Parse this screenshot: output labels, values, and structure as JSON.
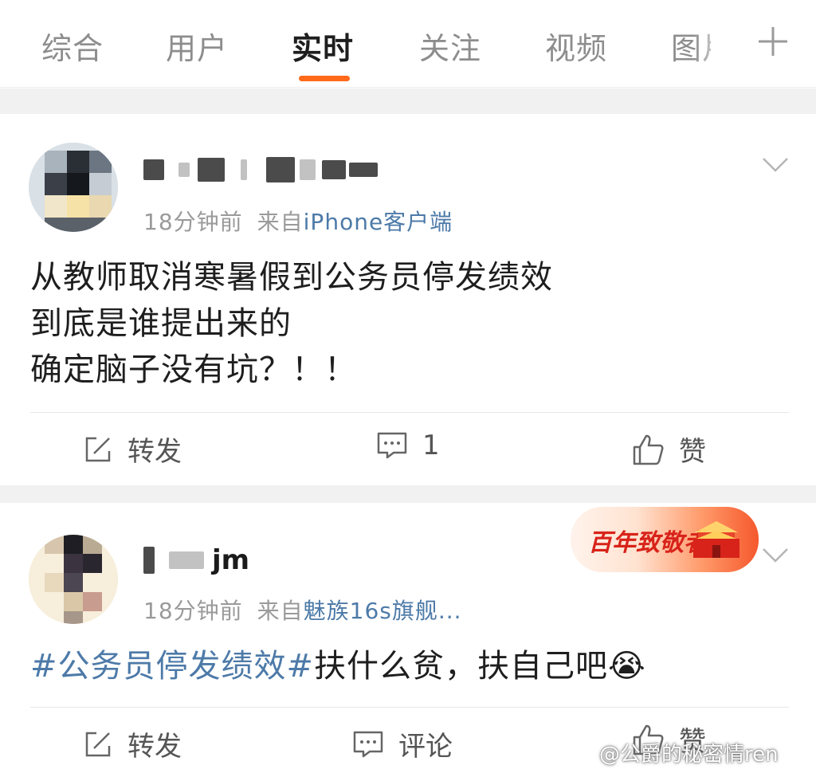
{
  "tabs": [
    {
      "label": "综合",
      "active": false
    },
    {
      "label": "用户",
      "active": false
    },
    {
      "label": "实时",
      "active": true
    },
    {
      "label": "关注",
      "active": false
    },
    {
      "label": "视频",
      "active": false
    },
    {
      "label": "图片",
      "active": false
    }
  ],
  "accent_color": "#ff6a1a",
  "link_color": "#4d7aa8",
  "posts": [
    {
      "username": "",
      "time": "18分钟前",
      "source_prefix": "来自",
      "source": "iPhone客户端",
      "content_lines": [
        "从教师取消寒暑假到公务员停发绩效",
        "到底是谁提出来的",
        "确定脑子没有坑？！！"
      ],
      "actions": {
        "repost": "转发",
        "comment": "1",
        "like": "赞"
      }
    },
    {
      "username": "jm",
      "time": "18分钟前",
      "source_prefix": "来自",
      "source": "魅族16s旗舰...",
      "hashtag": "#公务员停发绩效#",
      "text": "扶什么贫，扶自己吧",
      "emoji": "😭",
      "badge": "百年致敬者",
      "actions": {
        "repost": "转发",
        "comment": "评论",
        "like": "赞"
      }
    }
  ],
  "watermark": "@公爵的秘密情ren"
}
